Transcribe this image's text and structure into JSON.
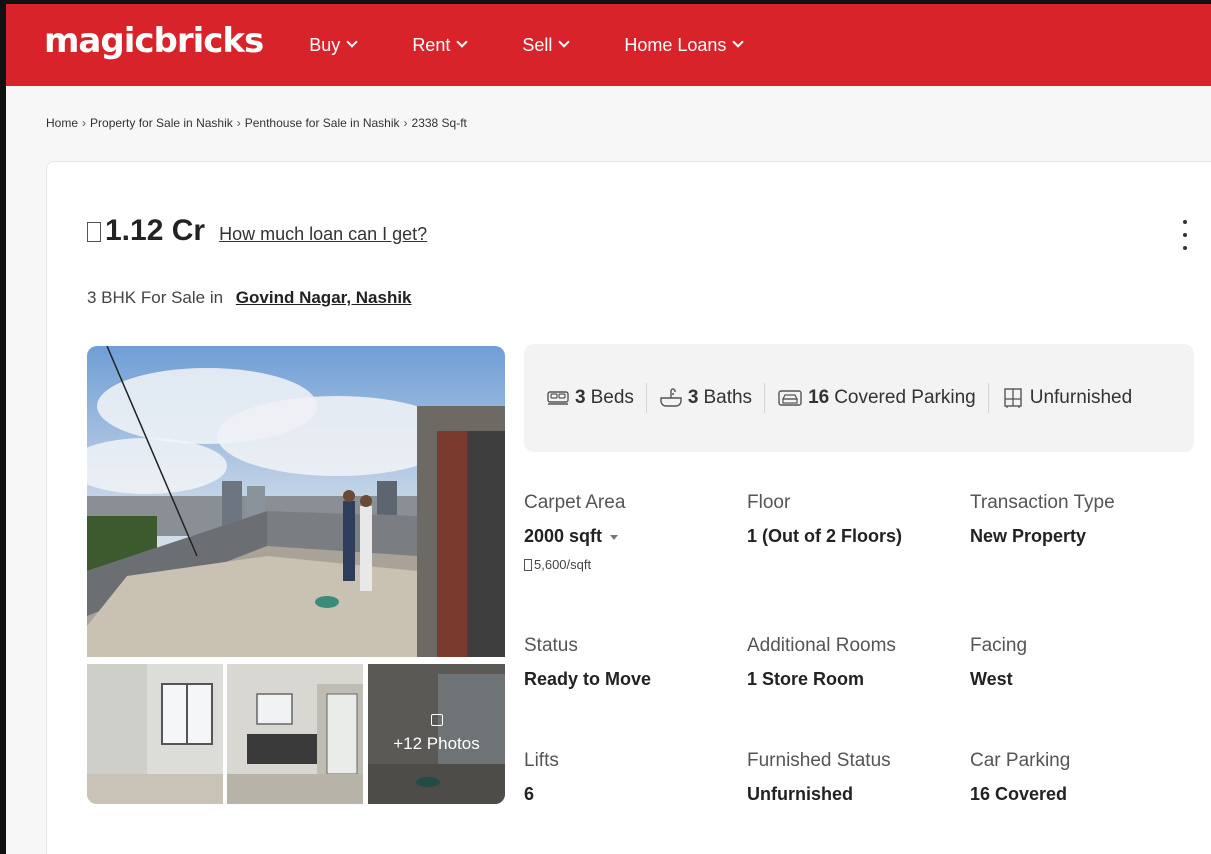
{
  "header": {
    "logo": "magicbricks",
    "nav": [
      {
        "label": "Buy"
      },
      {
        "label": "Rent"
      },
      {
        "label": "Sell"
      },
      {
        "label": "Home Loans"
      }
    ]
  },
  "breadcrumb": [
    "Home",
    "Property for Sale in Nashik",
    "Penthouse for Sale in Nashik",
    "2338 Sq-ft"
  ],
  "listing": {
    "price": "1.12 Cr",
    "loan_link": "How much loan can I get?",
    "subtitle_prefix": "3 BHK For Sale in",
    "location": "Govind Nagar, Nashik",
    "more_photos": "+12 Photos"
  },
  "amenities": {
    "beds_count": "3",
    "beds_label": "Beds",
    "baths_count": "3",
    "baths_label": "Baths",
    "parking_count": "16",
    "parking_label": "Covered Parking",
    "furnishing_label": "Unfurnished"
  },
  "details": {
    "carpet_area": {
      "label": "Carpet Area",
      "value": "2000 sqft",
      "sub": "5,600/sqft"
    },
    "floor": {
      "label": "Floor",
      "value": "1 (Out of 2 Floors)"
    },
    "transaction_type": {
      "label": "Transaction Type",
      "value": "New Property"
    },
    "status": {
      "label": "Status",
      "value": "Ready to Move"
    },
    "additional_rooms": {
      "label": "Additional Rooms",
      "value": "1 Store Room"
    },
    "facing": {
      "label": "Facing",
      "value": "West"
    },
    "lifts": {
      "label": "Lifts",
      "value": "6"
    },
    "furnished_status": {
      "label": "Furnished Status",
      "value": "Unfurnished"
    },
    "car_parking": {
      "label": "Car Parking",
      "value": "16 Covered"
    }
  },
  "colors": {
    "brand": "#d8232a",
    "amenity_bg": "#f3f3f3"
  }
}
